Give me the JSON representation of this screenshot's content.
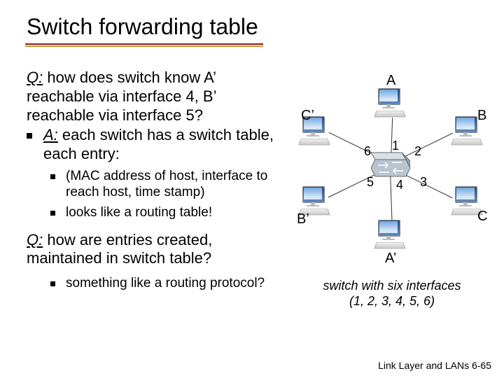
{
  "title": "Switch forwarding table",
  "q1": {
    "label": "Q:",
    "text": " how does switch know A’ reachable via interface 4, B’ reachable via interface 5?"
  },
  "a": {
    "label": "A:",
    "text": "  each switch has a switch table, each entry:",
    "sub": [
      "(MAC address of host, interface to reach host, time stamp)",
      "looks like a routing table!"
    ]
  },
  "q2": {
    "label": "Q:",
    "text": " how are entries created, maintained in switch table?",
    "sub": [
      "something like a routing protocol?"
    ]
  },
  "diagram": {
    "hosts": [
      "A",
      "B",
      "C",
      "A’",
      "B’",
      "C’"
    ],
    "ports": [
      "1",
      "2",
      "3",
      "4",
      "5",
      "6"
    ],
    "caption_line1": "switch with six interfaces",
    "caption_line2": "(1, 2, 3, 4, 5, 6)"
  },
  "footer": {
    "section": "Link Layer and LANs",
    "page": "  6-65"
  }
}
